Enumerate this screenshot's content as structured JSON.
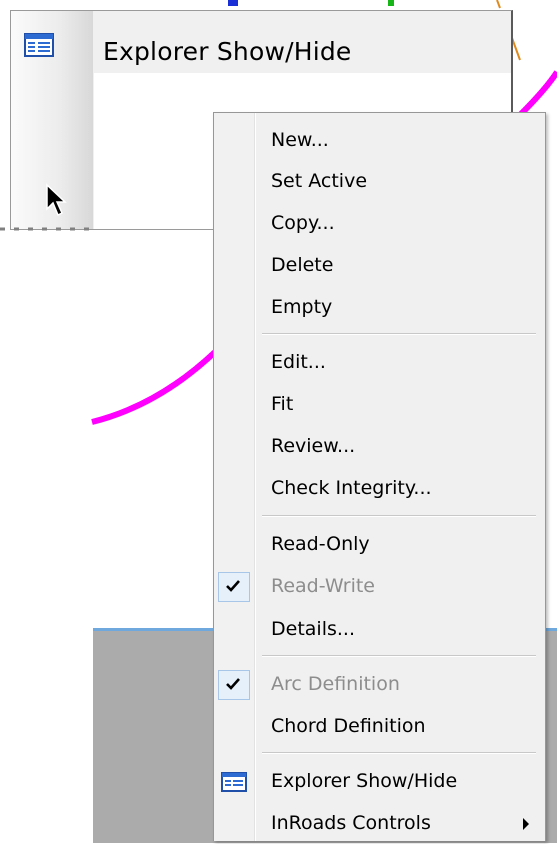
{
  "back_window": {
    "title": "Explorer Show/Hide"
  },
  "menu": {
    "items": [
      {
        "label": "New...",
        "enabled": true
      },
      {
        "label": "Set Active",
        "enabled": true
      },
      {
        "label": "Copy...",
        "enabled": true
      },
      {
        "label": "Delete",
        "enabled": true
      },
      {
        "label": "Empty",
        "enabled": true
      },
      {
        "label": "Edit...",
        "enabled": true
      },
      {
        "label": "Fit",
        "enabled": true
      },
      {
        "label": "Review...",
        "enabled": true
      },
      {
        "label": "Check Integrity...",
        "enabled": true
      },
      {
        "label": "Read-Only",
        "enabled": true
      },
      {
        "label": "Read-Write",
        "enabled": false,
        "checked": true
      },
      {
        "label": "Details...",
        "enabled": true
      },
      {
        "label": "Arc Definition",
        "enabled": false,
        "checked": true
      },
      {
        "label": "Chord Definition",
        "enabled": true
      },
      {
        "label": "Explorer Show/Hide",
        "enabled": true,
        "icon": "explorer-icon"
      },
      {
        "label": "InRoads Controls",
        "enabled": true,
        "submenu": true
      }
    ]
  },
  "colors": {
    "curve": "#ff00ff",
    "accent_blue": "#1a2fd6",
    "accent_green": "#17b517",
    "orange_line": "#e08a1e",
    "gray_panel": "#ababab"
  }
}
